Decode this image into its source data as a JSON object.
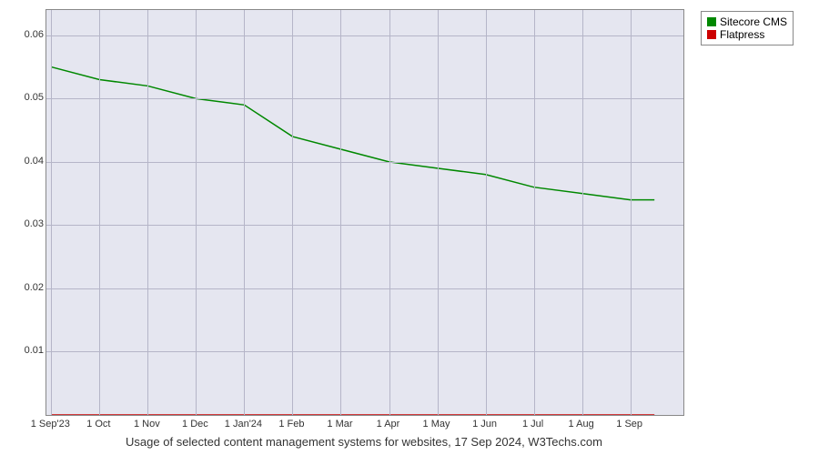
{
  "chart_data": {
    "type": "line",
    "x_categories": [
      "1 Sep'23",
      "1 Oct",
      "1 Nov",
      "1 Dec",
      "1 Jan'24",
      "1 Feb",
      "1 Mar",
      "1 Apr",
      "1 May",
      "1 Jun",
      "1 Jul",
      "1 Aug",
      "1 Sep"
    ],
    "series": [
      {
        "name": "Sitecore CMS",
        "color": "#008800",
        "values": [
          0.055,
          0.053,
          0.052,
          0.05,
          0.049,
          0.044,
          0.042,
          0.04,
          0.039,
          0.038,
          0.036,
          0.035,
          0.034
        ]
      },
      {
        "name": "Flatpress",
        "color": "#cc0000",
        "values": [
          0.0,
          0.0,
          0.0,
          0.0,
          0.0,
          0.0,
          0.0,
          0.0,
          0.0,
          0.0,
          0.0,
          0.0,
          0.0
        ]
      }
    ],
    "ylim": [
      0,
      0.064
    ],
    "y_ticks": [
      0.01,
      0.02,
      0.03,
      0.04,
      0.05,
      0.06
    ],
    "title": "",
    "caption": "Usage of selected content management systems for websites, 17 Sep 2024, W3Techs.com"
  },
  "legend": {
    "items": [
      {
        "label": "Sitecore CMS",
        "color": "#008800"
      },
      {
        "label": "Flatpress",
        "color": "#cc0000"
      }
    ]
  }
}
